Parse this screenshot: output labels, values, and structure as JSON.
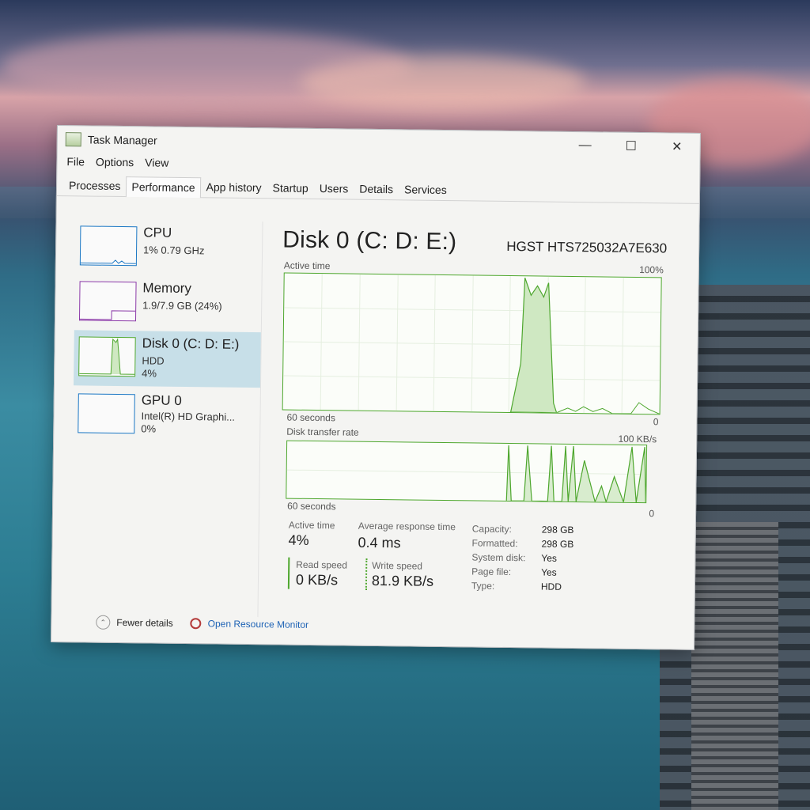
{
  "window": {
    "title": "Task Manager"
  },
  "menu": [
    "File",
    "Options",
    "View"
  ],
  "tabs": [
    "Processes",
    "Performance",
    "App history",
    "Startup",
    "Users",
    "Details",
    "Services"
  ],
  "active_tab": "Performance",
  "sidebar": [
    {
      "title": "CPU",
      "line1": "1% 0.79 GHz",
      "line2": "",
      "color": "#1b77c4"
    },
    {
      "title": "Memory",
      "line1": "1.9/7.9 GB (24%)",
      "line2": "",
      "color": "#8b39a8"
    },
    {
      "title": "Disk 0 (C: D: E:)",
      "line1": "HDD",
      "line2": "4%",
      "color": "#4ea72e"
    },
    {
      "title": "GPU 0",
      "line1": "Intel(R) HD Graphi...",
      "line2": "0%",
      "color": "#1b77c4"
    }
  ],
  "main": {
    "title": "Disk 0 (C: D: E:)",
    "model": "HGST HTS725032A7E630",
    "graph1": {
      "label": "Active time",
      "max_label": "100%",
      "x_label": "60 seconds",
      "min_label": "0"
    },
    "graph2": {
      "label": "Disk transfer rate",
      "max_label": "100 KB/s",
      "x_label": "60 seconds",
      "min_label": "0"
    }
  },
  "stats": {
    "active_time_label": "Active time",
    "active_time_value": "4%",
    "avg_response_label": "Average response time",
    "avg_response_value": "0.4 ms",
    "read_speed_label": "Read speed",
    "read_speed_value": "0 KB/s",
    "write_speed_label": "Write speed",
    "write_speed_value": "81.9 KB/s"
  },
  "properties": [
    {
      "label": "Capacity:",
      "value": "298 GB"
    },
    {
      "label": "Formatted:",
      "value": "298 GB"
    },
    {
      "label": "System disk:",
      "value": "Yes"
    },
    {
      "label": "Page file:",
      "value": "Yes"
    },
    {
      "label": "Type:",
      "value": "HDD"
    }
  ],
  "footer": {
    "fewer_details": "Fewer details",
    "resource_monitor": "Open Resource Monitor"
  },
  "colors": {
    "disk_green": "#4ea72e",
    "selected_bg": "#c7dfe8",
    "link": "#1f63b5"
  }
}
